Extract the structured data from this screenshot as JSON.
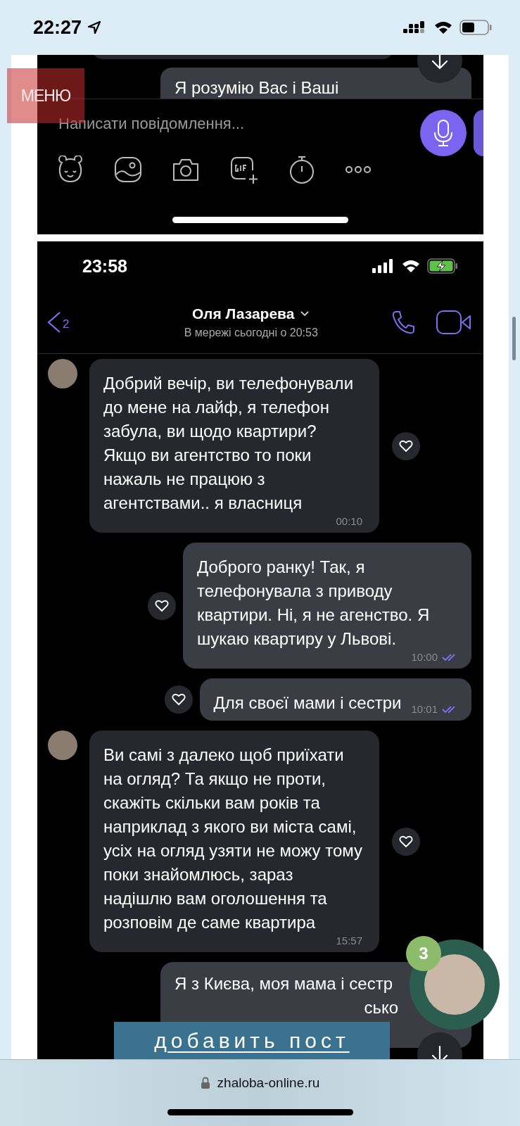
{
  "status_bar": {
    "time": "22:27"
  },
  "menu_button": {
    "label": "МЕНЮ"
  },
  "screenshot_1": {
    "partial_message": "Я розумію Вас і Ваші",
    "input_placeholder": "Написати повідомлення..."
  },
  "screenshot_2": {
    "status_time": "23:58",
    "back_count": "2",
    "contact_name": "Оля Лазарева",
    "last_seen": "В мережі сьогодні о 20:53",
    "messages": [
      {
        "kind": "incoming",
        "text": "Добрий вечір, ви телефонували до мене на лайф, я телефон забула, ви щодо квартири? Якщо ви агентство то поки нажаль не працюю з агентствами.. я власниця",
        "time": "00:10"
      },
      {
        "kind": "outgoing",
        "text": "Доброго ранку! Так, я телефонувала з приводу квартири. Ні, я не агенство. Я шукаю квартиру у Львові.",
        "time": "10:00"
      },
      {
        "kind": "outgoing",
        "text": "Для своєї мами і сестри",
        "time": "10:01"
      },
      {
        "kind": "incoming",
        "text": "Ви самі з далеко щоб приїхати на огляд? Та якщо не проти, скажіть скільки вам років та наприклад з якого ви міста самі, усіх на огляд узяти не можу тому поки знайомлюсь, зараз надішлю вам оголошення та розповім де саме квартира",
        "time": "15:57"
      }
    ],
    "partial_message": {
      "line_1": "Я з Києва, моя мама і сестр",
      "line_2": "сько"
    }
  },
  "add_post_button": {
    "label": "добавить пост"
  },
  "chat_widget": {
    "badge": "3"
  },
  "browser": {
    "url": "zhaloba-online.ru"
  }
}
